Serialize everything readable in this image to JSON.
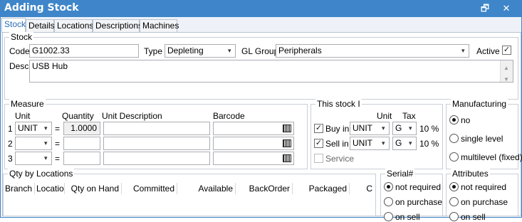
{
  "window": {
    "title": "Adding Stock",
    "restore_glyph": "🗗",
    "close_glyph": "✕"
  },
  "tabs": [
    "Stock",
    "Details",
    "Locations",
    "Descriptions",
    "Machines"
  ],
  "stock": {
    "legend": "Stock",
    "code_label": "Code",
    "code_value": "G1002.33",
    "type_label": "Type",
    "type_value": "Depleting",
    "gl_label": "GL Group",
    "gl_value": "Peripherals",
    "active_label": "Active",
    "active_checked": true,
    "desc_label": "Desc",
    "desc_value": "USB Hub"
  },
  "measure": {
    "legend": "Measure",
    "headers": {
      "unit": "Unit",
      "quantity": "Quantity",
      "unit_desc": "Unit Description",
      "barcode": "Barcode"
    },
    "rows": [
      {
        "num": "1",
        "unit": "UNIT",
        "eq": "=",
        "qty": "1.0000"
      },
      {
        "num": "2",
        "unit": "",
        "eq": "=",
        "qty": ""
      },
      {
        "num": "3",
        "unit": "",
        "eq": "=",
        "qty": ""
      }
    ]
  },
  "this_stock": {
    "legend": "This stock I",
    "unit_header": "Unit",
    "tax_header": "Tax",
    "buy_label": "Buy in",
    "buy_unit": "UNIT",
    "buy_tax": "G",
    "buy_pct": "10 %",
    "sell_label": "Sell in",
    "sell_unit": "UNIT",
    "sell_tax": "G",
    "sell_pct": "10 %",
    "service_label": "Service"
  },
  "manufacturing": {
    "legend": "Manufacturing",
    "options": [
      "no",
      "single level",
      "multilevel (fixed)"
    ],
    "selected": 0
  },
  "qty_locations": {
    "legend": "Qty by Locations",
    "columns": [
      "Branch",
      "Locatio",
      "Qty on Hand",
      "Committed",
      "Available",
      "BackOrder",
      "Packaged",
      "C"
    ]
  },
  "serial": {
    "legend": "Serial#",
    "options": [
      "not required",
      "on purchase",
      "on sell"
    ],
    "selected": 0
  },
  "attributes": {
    "legend": "Attributes",
    "options": [
      "not required",
      "on purchase",
      "on sell"
    ],
    "selected": 0
  },
  "icons": {
    "dropdown": "▾",
    "check": "✓",
    "scroll_up": "▲",
    "scroll_down": "▼"
  },
  "colors": {
    "titlebar": "#3e86c9",
    "active_tab_text": "#2a6db5"
  }
}
